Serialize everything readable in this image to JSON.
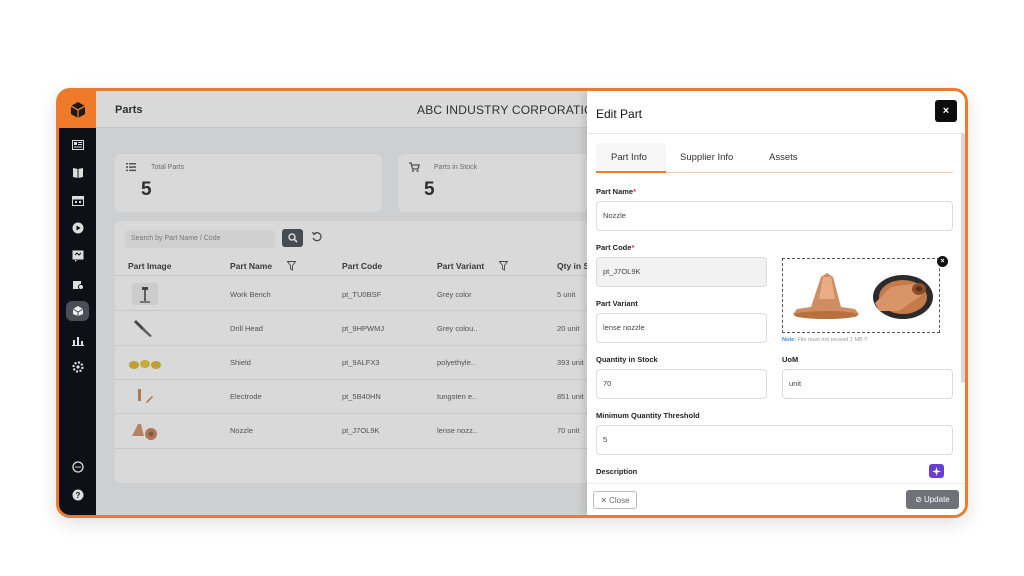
{
  "header": {
    "title": "Parts",
    "company": "ABC INDUSTRY CORPORATION"
  },
  "cards": [
    {
      "label": "Total Parts",
      "value": "5"
    },
    {
      "label": "Parts in Stock",
      "value": "5"
    }
  ],
  "search": {
    "placeholder": "Search by Part Name / Code"
  },
  "table": {
    "columns": [
      "Part Image",
      "Part Name",
      "Part Code",
      "Part Variant",
      "Qty in S"
    ],
    "rows": [
      {
        "name": "Work Bench",
        "code": "pt_TU0BSF",
        "variant": "Grey color",
        "qty": "5 unit"
      },
      {
        "name": "Drill Head",
        "code": "pt_9HPWMJ",
        "variant": "Grey colou..",
        "qty": "20 unit"
      },
      {
        "name": "Shield",
        "code": "pt_9ALFX3",
        "variant": "polyethyle..",
        "qty": "393 unit"
      },
      {
        "name": "Electrode",
        "code": "pt_5B40HN",
        "variant": "tungsten e..",
        "qty": "851 unit"
      },
      {
        "name": "Nozzle",
        "code": "pt_J7OL9K",
        "variant": "lense nozz..",
        "qty": "70 unit"
      }
    ]
  },
  "panel": {
    "title": "Edit Part",
    "close_symbol": "×",
    "tabs": [
      "Part Info",
      "Supplier Info",
      "Assets"
    ],
    "fields": {
      "part_name_label": "Part Name",
      "part_name": "Nozzle",
      "part_code_label": "Part Code",
      "part_code": "pt_J7OL9K",
      "part_variant_label": "Part Variant",
      "part_variant": "lense nozzle",
      "qty_label": "Quantity in Stock",
      "qty": "70",
      "uom_label": "UoM",
      "uom": "unit",
      "min_qty_label": "Minimum Quantity Threshold",
      "min_qty": "5",
      "description_label": "Description",
      "required_mark": "*"
    },
    "note_prefix": "Note:",
    "note_text": "File must not exceed 1 MB !!",
    "close_button": "Close",
    "update_button": "Update"
  },
  "colors": {
    "accent": "#ee7a2a",
    "sidebar": "#0d1117",
    "ai": "#6a3fd0"
  }
}
